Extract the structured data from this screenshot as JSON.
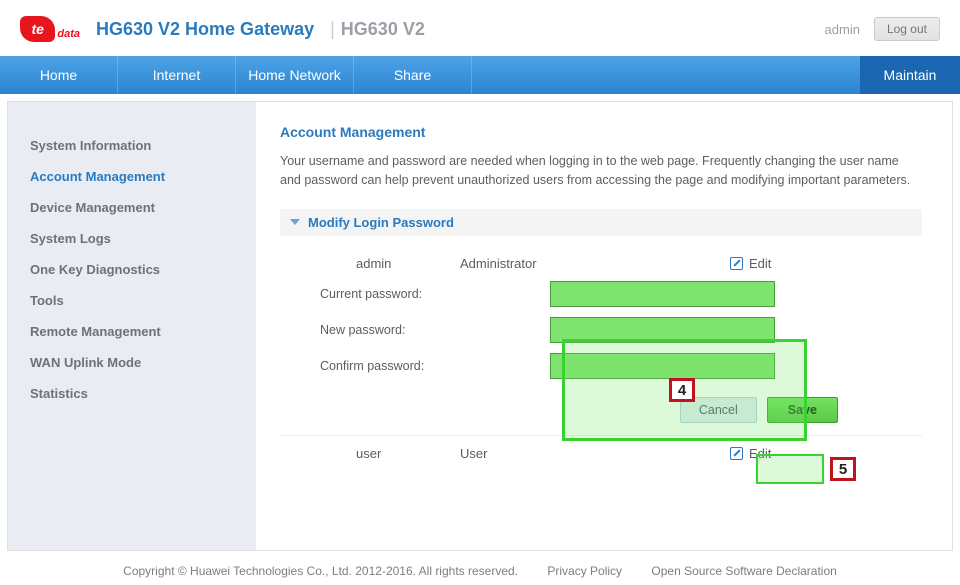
{
  "header": {
    "logo_text": "te",
    "logo_suffix": "data",
    "product_title": "HG630 V2 Home Gateway",
    "model": "HG630 V2",
    "user": "admin",
    "logout": "Log out"
  },
  "nav": {
    "items": [
      "Home",
      "Internet",
      "Home Network",
      "Share"
    ],
    "active": "Maintain"
  },
  "sidebar": {
    "items": [
      "System Information",
      "Account Management",
      "Device Management",
      "System Logs",
      "One Key Diagnostics",
      "Tools",
      "Remote Management",
      "WAN Uplink Mode",
      "Statistics"
    ],
    "active_index": 1
  },
  "content": {
    "title": "Account Management",
    "description": "Your username and password are needed when logging in to the web page. Frequently changing the user name and password can help prevent unauthorized users from accessing the page and modifying important parameters.",
    "section_title": "Modify Login Password",
    "accounts": [
      {
        "username": "admin",
        "role": "Administrator",
        "edit": "Edit"
      },
      {
        "username": "user",
        "role": "User",
        "edit": "Edit"
      }
    ],
    "form": {
      "current_label": "Current password:",
      "new_label": "New password:",
      "confirm_label": "Confirm password:",
      "current_value": "",
      "new_value": "",
      "confirm_value": ""
    },
    "buttons": {
      "cancel": "Cancel",
      "save": "Save"
    },
    "callouts": {
      "four": "4",
      "five": "5"
    }
  },
  "footer": {
    "copyright": "Copyright © Huawei Technologies Co., Ltd. 2012-2016. All rights reserved.",
    "privacy": "Privacy Policy",
    "opensource": "Open Source Software Declaration"
  }
}
